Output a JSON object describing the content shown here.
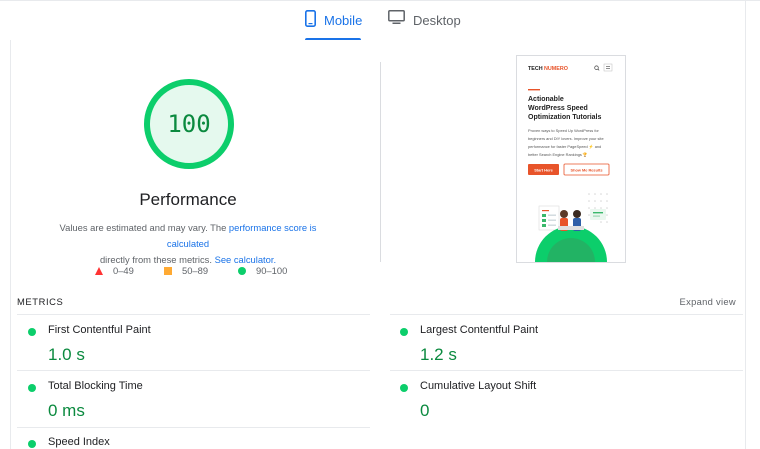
{
  "tabs": [
    {
      "label": "Mobile",
      "icon": "smartphone-icon",
      "active": true
    },
    {
      "label": "Desktop",
      "icon": "monitor-icon",
      "active": false
    }
  ],
  "score": {
    "value": "100",
    "title": "Performance",
    "color": "#0cce6b"
  },
  "estimate": {
    "prefix": "Values are estimated and may vary. The ",
    "link1": "performance score is calculated",
    "middle": "directly from these metrics.",
    "link2": "See calculator."
  },
  "legend": [
    {
      "range": "0–49",
      "shape": "triangle",
      "color": "#ff3333"
    },
    {
      "range": "50–89",
      "shape": "square",
      "color": "#ffaa33"
    },
    {
      "range": "90–100",
      "shape": "circle",
      "color": "#0cce6b"
    }
  ],
  "preview": {
    "brand_a": "TECH",
    "brand_b": "NUMERO",
    "headline": "Actionable WordPress Speed Optimization Tutorials",
    "body": "Proven ways to Speed Up WordPress for beginners and DIY lovers. Improve your site performance for faster PageSpeed and better Search Engine Rankings",
    "btn_primary": "Start Here",
    "btn_secondary": "Show Me Results"
  },
  "metrics": {
    "label": "METRICS",
    "expand": "Expand view",
    "items": [
      {
        "name": "First Contentful Paint",
        "value": "1.0 s"
      },
      {
        "name": "Largest Contentful Paint",
        "value": "1.2 s"
      },
      {
        "name": "Total Blocking Time",
        "value": "0 ms"
      },
      {
        "name": "Cumulative Layout Shift",
        "value": "0"
      },
      {
        "name": "Speed Index",
        "value": ""
      }
    ]
  },
  "colors": {
    "accent": "#1a73e8",
    "good": "#0cce6b",
    "good_text": "#0b8a3f"
  }
}
